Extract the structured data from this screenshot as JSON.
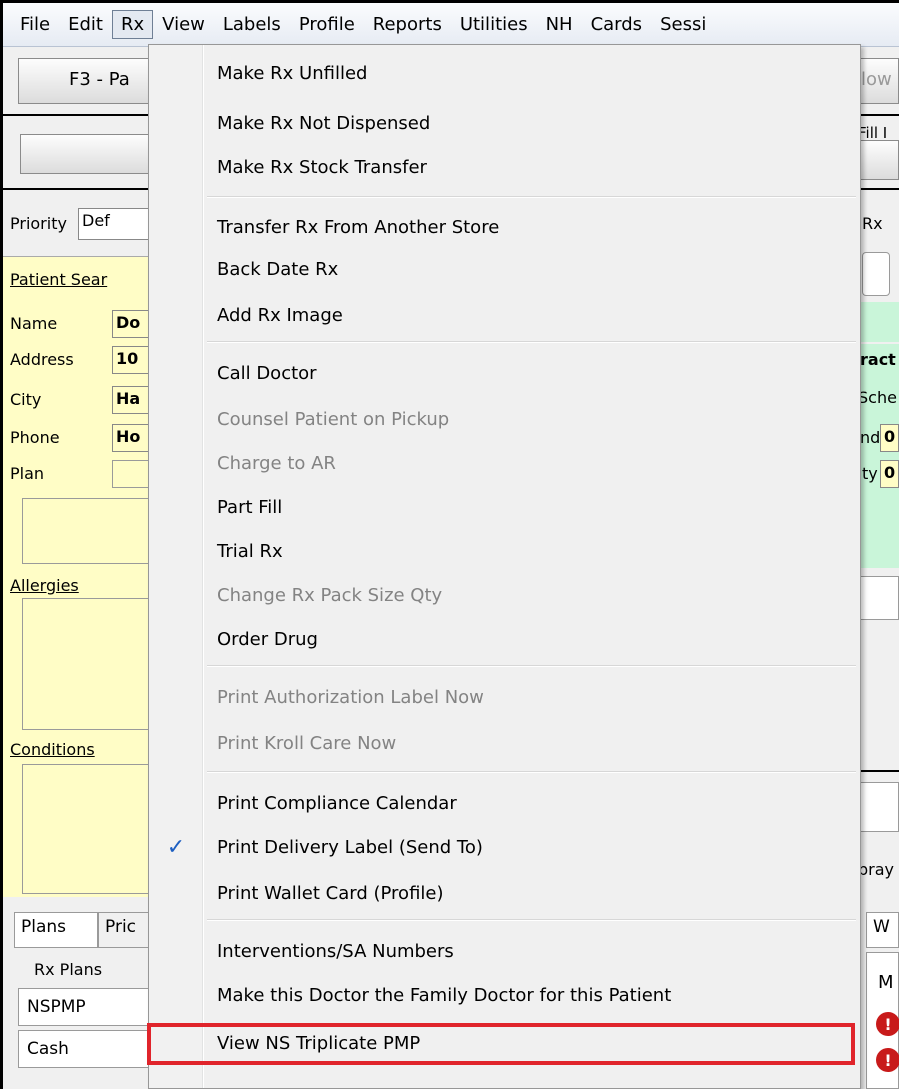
{
  "menubar": {
    "items": [
      "File",
      "Edit",
      "Rx",
      "View",
      "Labels",
      "Profile",
      "Reports",
      "Utilities",
      "NH",
      "Cards",
      "Sessi"
    ]
  },
  "background": {
    "f3_button": "F3 - Pa",
    "low_button": "low",
    "fill_label": "Fill I",
    "rx_label": "Rx",
    "left_col": {
      "priority_label": "Priority",
      "priority_value": "Def",
      "patient_search": "Patient Sear",
      "name_label": "Name",
      "name_value": "Do",
      "address_label": "Address",
      "address_value": "10",
      "city_label": "City",
      "city_value": "Ha",
      "phone_label": "Phone",
      "phone_value": "Ho",
      "plan_label": "Plan",
      "allergies_label": "Allergies",
      "conditions_label": "Conditions",
      "tab_plans": "Plans",
      "tab_pric": "Pric",
      "rx_plans_label": "Rx Plans",
      "plan_rows": [
        "NSPMP",
        "Cash"
      ]
    },
    "right_col": {
      "ract": "ract",
      "sche": "Sche",
      "nd": "nd",
      "ty": "ty",
      "zero": "0",
      "pray": "pray",
      "w": "W",
      "m": "M",
      "err": "!"
    }
  },
  "rx_menu": {
    "items": [
      {
        "label": "Make Rx Unfilled",
        "enabled": true
      },
      {
        "label": "Make Rx Not Dispensed",
        "enabled": true
      },
      {
        "label": "Make Rx Stock Transfer",
        "enabled": true
      },
      {
        "label": "Transfer Rx From Another Store",
        "enabled": true
      },
      {
        "label": "Back Date Rx",
        "enabled": true
      },
      {
        "label": "Add Rx Image",
        "enabled": true
      },
      {
        "label": "Call Doctor",
        "enabled": true
      },
      {
        "label": "Counsel Patient on Pickup",
        "enabled": false
      },
      {
        "label": "Charge to AR",
        "enabled": false
      },
      {
        "label": "Part Fill",
        "enabled": true
      },
      {
        "label": "Trial Rx",
        "enabled": true
      },
      {
        "label": "Change Rx Pack Size Qty",
        "enabled": false
      },
      {
        "label": "Order Drug",
        "enabled": true
      },
      {
        "label": "Print Authorization Label Now",
        "enabled": false
      },
      {
        "label": "Print Kroll Care Now",
        "enabled": false
      },
      {
        "label": "Print Compliance Calendar",
        "enabled": true
      },
      {
        "label": "Print Delivery Label (Send To)",
        "enabled": true,
        "checked": true
      },
      {
        "label": "Print Wallet Card (Profile)",
        "enabled": true
      },
      {
        "label": "Interventions/SA Numbers",
        "enabled": true
      },
      {
        "label": "Make this Doctor the Family Doctor for this Patient",
        "enabled": true
      },
      {
        "label": "View NS Triplicate PMP",
        "enabled": true,
        "highlighted": true
      }
    ]
  },
  "colors": {
    "highlight_border": "#e0242b",
    "check_color": "#1d5fc1",
    "disabled_text": "#838383",
    "patient_panel": "#fffdc6",
    "drug_panel": "#c9f5d9"
  }
}
